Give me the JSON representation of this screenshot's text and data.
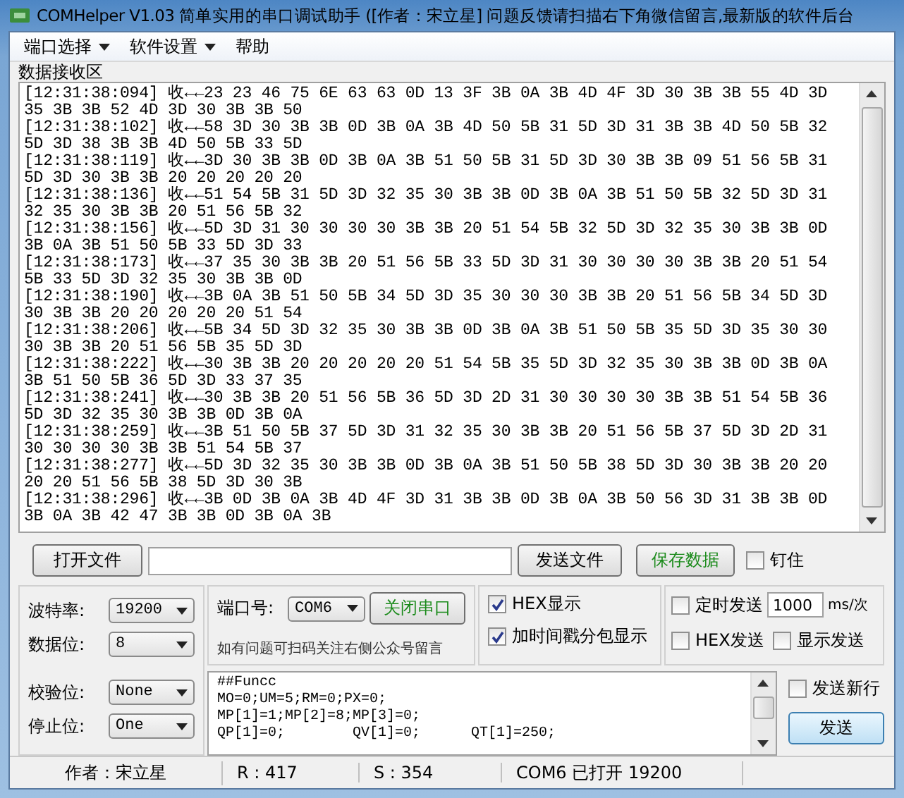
{
  "window": {
    "title": "COMHelper V1.03 简单实用的串口调试助手 ([作者：宋立星] 问题反馈请扫描右下角微信留言,最新版的软件后台"
  },
  "menu": [
    {
      "label": "端口选择",
      "has_caret": true
    },
    {
      "label": "软件设置",
      "has_caret": true
    },
    {
      "label": "帮助",
      "has_caret": false
    }
  ],
  "receive_area": {
    "label": "数据接收区",
    "lines": [
      "[12:31:38:094] 收←←23 23 46 75 6E 63 63 0D 13 3F 3B 0A 3B 4D 4F 3D 30 3B 3B 55 4D 3D 35 3B 3B 52 4D 3D 30 3B 3B 50",
      "[12:31:38:102] 收←←58 3D 30 3B 3B 0D 3B 0A 3B 4D 50 5B 31 5D 3D 31 3B 3B 4D 50 5B 32 5D 3D 38 3B 3B 4D 50 5B 33 5D",
      "[12:31:38:119] 收←←3D 30 3B 3B 0D 3B 0A 3B 51 50 5B 31 5D 3D 30 3B 3B 09 51 56 5B 31 5D 3D 30 3B 3B 20 20 20 20 20",
      "[12:31:38:136] 收←←51 54 5B 31 5D 3D 32 35 30 3B 3B 0D 3B 0A 3B 51 50 5B 32 5D 3D 31 32 35 30 3B 3B 20 51 56 5B 32",
      "[12:31:38:156] 收←←5D 3D 31 30 30 30 30 3B 3B 20 51 54 5B 32 5D 3D 32 35 30 3B 3B 0D 3B 0A 3B 51 50 5B 33 5D 3D 33",
      "[12:31:38:173] 收←←37 35 30 3B 3B 20 51 56 5B 33 5D 3D 31 30 30 30 30 3B 3B 20 51 54 5B 33 5D 3D 32 35 30 3B 3B 0D",
      "[12:31:38:190] 收←←3B 0A 3B 51 50 5B 34 5D 3D 35 30 30 30 3B 3B 20 51 56 5B 34 5D 3D 30 3B 3B 20 20 20 20 20 51 54",
      "[12:31:38:206] 收←←5B 34 5D 3D 32 35 30 3B 3B 0D 3B 0A 3B 51 50 5B 35 5D 3D 35 30 30 30 3B 3B 20 51 56 5B 35 5D 3D",
      "[12:31:38:222] 收←←30 3B 3B 20 20 20 20 20 51 54 5B 35 5D 3D 32 35 30 3B 3B 0D 3B 0A 3B 51 50 5B 36 5D 3D 33 37 35",
      "[12:31:38:241] 收←←30 3B 3B 20 51 56 5B 36 5D 3D 2D 31 30 30 30 30 3B 3B 51 54 5B 36 5D 3D 32 35 30 3B 3B 0D 3B 0A",
      "[12:31:38:259] 收←←3B 51 50 5B 37 5D 3D 31 32 35 30 3B 3B 20 51 56 5B 37 5D 3D 2D 31 30 30 30 30 3B 3B 51 54 5B 37",
      "[12:31:38:277] 收←←5D 3D 32 35 30 3B 3B 0D 3B 0A 3B 51 50 5B 38 5D 3D 30 3B 3B 20 20 20 20 51 56 5B 38 5D 3D 30 3B",
      "[12:31:38:296] 收←←3B 0D 3B 0A 3B 4D 4F 3D 31 3B 3B 0D 3B 0A 3B 50 56 3D 31 3B 3B 0D 3B 0A 3B 42 47 3B 3B 0D 3B 0A 3B"
    ]
  },
  "file_bar": {
    "open_button": "打开文件",
    "send_file_button": "发送文件",
    "save_button": "保存数据",
    "pin": {
      "label": "钉住",
      "checked": false
    }
  },
  "serial_settings": [
    {
      "label": "波特率:",
      "value": "19200"
    },
    {
      "label": "数据位:",
      "value": "8"
    },
    {
      "label": "校验位:",
      "value": "None"
    },
    {
      "label": "停止位:",
      "value": "One"
    }
  ],
  "port": {
    "label": "端口号:",
    "value": "COM6",
    "close_button": "关闭串口",
    "note": "如有问题可扫码关注右侧公众号留言"
  },
  "display_options": [
    {
      "label": "HEX显示",
      "checked": true
    },
    {
      "label": "加时间戳分包显示",
      "checked": true
    }
  ],
  "send_options": {
    "timer": {
      "label": "定时发送",
      "checked": false
    },
    "interval": "1000",
    "unit": "ms/次",
    "hex_send": {
      "label": "HEX发送",
      "checked": false
    },
    "show_send": {
      "label": "显示发送",
      "checked": false
    }
  },
  "send_text": [
    "##Funcc",
    "MO=0;UM=5;RM=0;PX=0;",
    "MP[1]=1;MP[2]=8;MP[3]=0;",
    "QP[1]=0;        QV[1]=0;      QT[1]=250;"
  ],
  "send_newline": {
    "label": "发送新行",
    "checked": false
  },
  "send_button": "发送",
  "status_bar": [
    "作者：宋立星",
    "R : 417",
    "S : 354",
    "COM6 已打开 19200"
  ]
}
